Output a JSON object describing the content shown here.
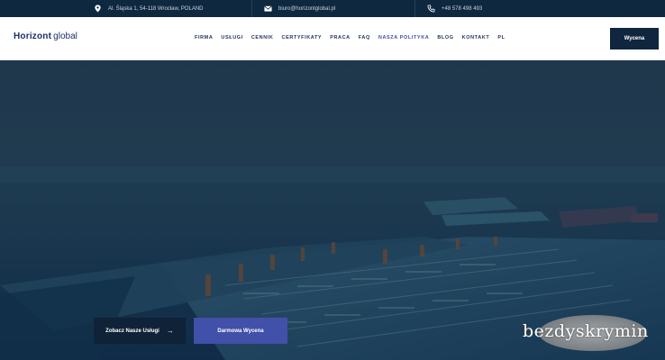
{
  "topbar": {
    "address": "Al. Śląska 1, 54-118 Wrocław, POLAND",
    "email": "biuro@horizontglobal.pl",
    "phone": "+48 578 498 493"
  },
  "header": {
    "logo_bold": "Horizont",
    "logo_light": "global",
    "nav": [
      "FIRMA",
      "USŁUGI",
      "CENNIK",
      "CERTYFIKATY",
      "PRACA",
      "FAQ",
      "NASZA POLITYKA",
      "BLOG",
      "KONTAKT",
      "PL"
    ],
    "active_nav": "NASZA POLITYKA",
    "cta_label": "Wycena"
  },
  "hero": {
    "primary_button": "Zobacz Nasze Usługi",
    "secondary_button": "Darmowa Wycena"
  },
  "watermark": {
    "text": "bezdyskrymin"
  },
  "colors": {
    "topbar_bg": "#0e2840",
    "header_bg": "#ffffff",
    "brand_navy": "#10253e",
    "accent_blue": "#4150a8",
    "active_nav": "#3d4fb0"
  }
}
